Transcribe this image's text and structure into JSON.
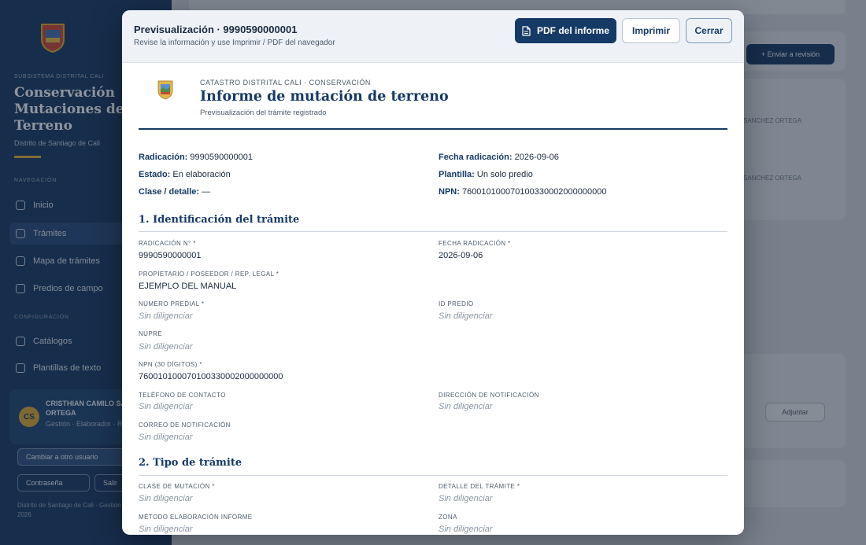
{
  "sidebar": {
    "org": "SUBSISTEMA DISTRITAL CALI",
    "title": "Conservación Mutaciones de Terreno",
    "subtitle": "Distrito de Santiago de Cali",
    "section_main": "NAVEGACIÓN",
    "section_config": "CONFIGURACIÓN",
    "items": [
      {
        "label": "Inicio"
      },
      {
        "label": "Trámites"
      },
      {
        "label": "Mapa de trámites"
      },
      {
        "label": "Predios de campo"
      },
      {
        "label": "Catálogos"
      },
      {
        "label": "Plantillas de texto"
      }
    ],
    "user": {
      "initials": "CS",
      "name": "CRISTHIAN CAMILO SANCHEZ ORTEGA",
      "role": "Gestión · Elaborador · Revisando"
    },
    "switch_label": "Cambiar a otro usuario",
    "btn_password": "Contraseña",
    "btn_exit": "Salir",
    "footer": "Distrito de Santiago de Cali · Gestión Catastral · 2026"
  },
  "background": {
    "action_button": "+ Enviar a revisión",
    "text_a": "SANCHEZ ORTEGA",
    "text_b": "SANCHEZ ORTEGA",
    "adjust_button": "Adjuntar"
  },
  "modal": {
    "title": "Previsualización · 9990590000001",
    "subtitle": "Revise la información y use Imprimir / PDF del navegador",
    "btn_pdf": "PDF del informe",
    "btn_print": "Imprimir",
    "btn_close": "Cerrar"
  },
  "document": {
    "kicker": "CATASTRO DISTRITAL CALI · CONSERVACIÓN",
    "title": "Informe de mutación de terreno",
    "caption": "Previsualización del trámite registrado",
    "meta": {
      "radicacion_label": "Radicación:",
      "radicacion": "9990590000001",
      "fecha_label": "Fecha radicación:",
      "fecha": "2026-09-06",
      "estado_label": "Estado:",
      "estado": "En elaboración",
      "plantilla_label": "Plantilla:",
      "plantilla": "Un solo predio",
      "clase_label": "Clase / detalle:",
      "clase": "—",
      "npn_label": "NPN:",
      "npn": "760010100070100330002000000000"
    },
    "empty_value": "Sin diligenciar",
    "section1": {
      "title": "1. Identificación del trámite",
      "fields": {
        "radicacion_label": "RADICACIÓN N° *",
        "radicacion_value": "9990590000001",
        "fecha_label": "FECHA RADICACIÓN *",
        "fecha_value": "2026-09-06",
        "propietario_label": "PROPIETARIO / POSEEDOR / REP. LEGAL *",
        "propietario_value": "EJEMPLO DEL MANUAL",
        "numero_predial_label": "NÚMERO PREDIAL *",
        "id_predio_label": "ID PREDIO",
        "nupre_label": "NUPRE",
        "npn_label": "NPN (30 DÍGITOS) *",
        "npn_value": "760010100070100330002000000000",
        "telefono_label": "TELÉFONO DE CONTACTO",
        "direccion_label": "DIRECCIÓN DE NOTIFICACIÓN",
        "correo_label": "CORREO DE NOTIFICACIÓN"
      }
    },
    "section2": {
      "title": "2. Tipo de trámite",
      "fields": {
        "clase_label": "CLASE DE MUTACIÓN *",
        "detalle_label": "DETALLE DEL TRÁMITE *",
        "metodo_label": "MÉTODO ELABORACIÓN INFORME",
        "zona_label": "ZONA"
      }
    }
  },
  "colors": {
    "brand_navy": "#163a66",
    "accent_gold": "#d4a63a",
    "empty_text": "#8a96a4"
  },
  "icons": {
    "pdf": "file-icon",
    "shield": "cali-shield-icon"
  }
}
